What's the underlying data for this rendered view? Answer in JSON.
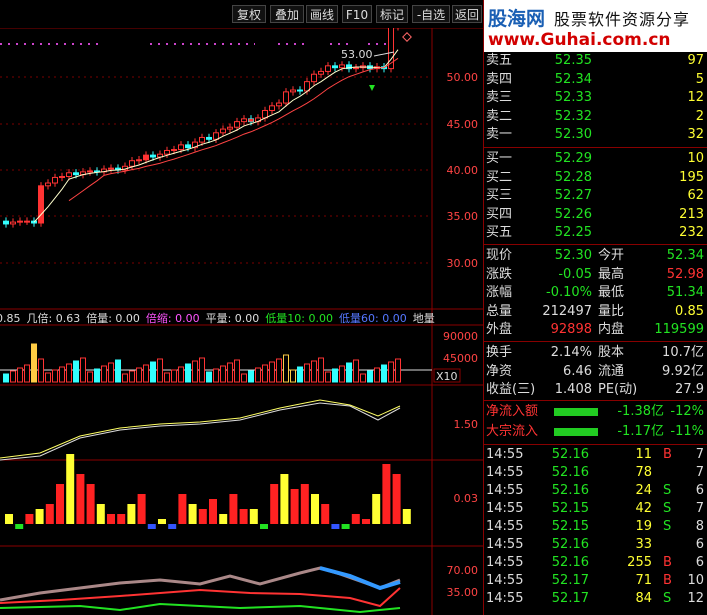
{
  "toolbar": {
    "buttons": [
      "复权",
      "叠加",
      "画线",
      "F10",
      "标记",
      "-自选",
      "返回"
    ]
  },
  "logo": {
    "site": "股海网",
    "slogan": "股票软件资源分享",
    "url": "www.Guhai.com.cn"
  },
  "chart": {
    "price_ticks": [
      "50.00",
      "45.00",
      "40.00",
      "35.00",
      "30.00"
    ],
    "peak_label": "53.00",
    "vol_ticks": [
      "90000",
      "45000"
    ],
    "vol_unit": "X10",
    "ind1_tick": "1.50",
    "ind2_tick": "0.03",
    "ind3_ticks": [
      "70.00",
      "35.00"
    ],
    "indicator_bar": [
      {
        "text": "0.85",
        "color": "#dddddd"
      },
      {
        "text": "几倍: 0.63",
        "color": "#dddddd"
      },
      {
        "text": "倍量: 0.00",
        "color": "#dddddd"
      },
      {
        "text": "倍缩: 0.00",
        "color": "#ff55ff"
      },
      {
        "text": "平量: 0.00",
        "color": "#dddddd"
      },
      {
        "text": "低量10: 0.00",
        "color": "#22e322"
      },
      {
        "text": "低量60: 0.00",
        "color": "#5577ff"
      },
      {
        "text": "地量",
        "color": "#dddddd"
      }
    ]
  },
  "orderbook": {
    "asks": [
      {
        "label": "卖五",
        "price": "52.35",
        "vol": "97"
      },
      {
        "label": "卖四",
        "price": "52.34",
        "vol": "5"
      },
      {
        "label": "卖三",
        "price": "52.33",
        "vol": "12"
      },
      {
        "label": "卖二",
        "price": "52.32",
        "vol": "2"
      },
      {
        "label": "卖一",
        "price": "52.30",
        "vol": "32"
      }
    ],
    "bids": [
      {
        "label": "买一",
        "price": "52.29",
        "vol": "10"
      },
      {
        "label": "买二",
        "price": "52.28",
        "vol": "195"
      },
      {
        "label": "买三",
        "price": "52.27",
        "vol": "62"
      },
      {
        "label": "买四",
        "price": "52.26",
        "vol": "213"
      },
      {
        "label": "买五",
        "price": "52.25",
        "vol": "232"
      }
    ]
  },
  "quote": {
    "rows": [
      {
        "l1": "现价",
        "v1": "52.30",
        "c1": "g",
        "l2": "今开",
        "v2": "52.34",
        "c2": "g"
      },
      {
        "l1": "涨跌",
        "v1": "-0.05",
        "c1": "g",
        "l2": "最高",
        "v2": "52.98",
        "c2": "r"
      },
      {
        "l1": "涨幅",
        "v1": "-0.10%",
        "c1": "g",
        "l2": "最低",
        "v2": "51.34",
        "c2": "g"
      },
      {
        "l1": "总量",
        "v1": "212497",
        "c1": "w",
        "l2": "量比",
        "v2": "0.85",
        "c2": "y"
      },
      {
        "l1": "外盘",
        "v1": "92898",
        "c1": "r",
        "l2": "内盘",
        "v2": "119599",
        "c2": "g"
      }
    ]
  },
  "stats": {
    "rows": [
      {
        "l1": "换手",
        "v1": "2.14%",
        "l2": "股本",
        "v2": "10.7亿"
      },
      {
        "l1": "净资",
        "v1": "6.46",
        "l2": "流通",
        "v2": "9.92亿"
      },
      {
        "l1": "收益(三)",
        "v1": "1.408",
        "l2": "PE(动)",
        "v2": "27.9"
      }
    ]
  },
  "flows": [
    {
      "label": "净流入额",
      "value": "-1.38亿",
      "pct": "-12%"
    },
    {
      "label": "大宗流入",
      "value": "-1.17亿",
      "pct": "-11%"
    }
  ],
  "ticks": [
    {
      "time": "14:55",
      "price": "52.16",
      "vol": "11",
      "side": "B",
      "n": "7"
    },
    {
      "time": "14:55",
      "price": "52.16",
      "vol": "78",
      "side": "",
      "n": "7"
    },
    {
      "time": "14:55",
      "price": "52.16",
      "vol": "24",
      "side": "S",
      "n": "6"
    },
    {
      "time": "14:55",
      "price": "52.15",
      "vol": "42",
      "side": "S",
      "n": "7"
    },
    {
      "time": "14:55",
      "price": "52.15",
      "vol": "19",
      "side": "S",
      "n": "8"
    },
    {
      "time": "14:55",
      "price": "52.16",
      "vol": "33",
      "side": "",
      "n": "6"
    },
    {
      "time": "14:55",
      "price": "52.16",
      "vol": "255",
      "side": "B",
      "n": "6"
    },
    {
      "time": "14:55",
      "price": "52.17",
      "vol": "71",
      "side": "B",
      "n": "10"
    },
    {
      "time": "14:55",
      "price": "52.17",
      "vol": "84",
      "side": "S",
      "n": "12"
    }
  ]
}
